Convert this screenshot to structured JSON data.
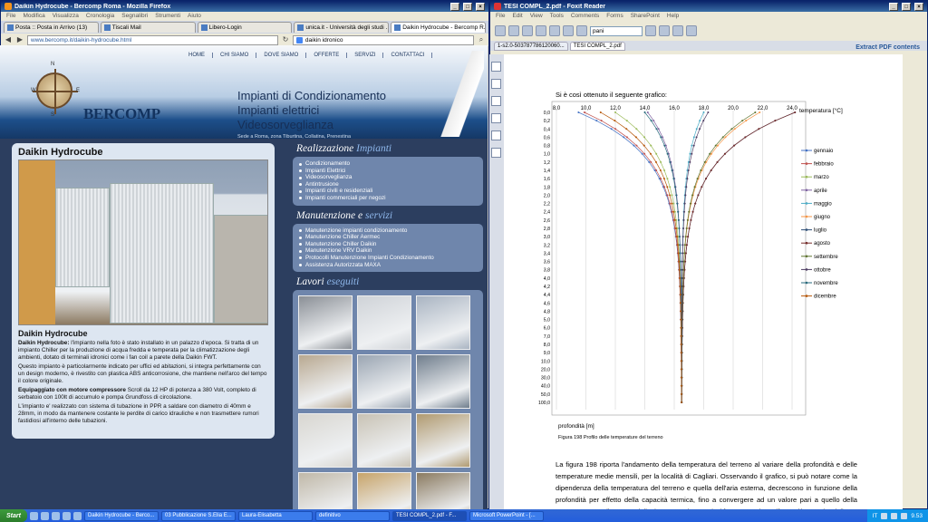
{
  "firefox": {
    "title": "Daikin Hydrocube - Bercomp Roma - Mozilla Firefox",
    "menu": [
      "File",
      "Modifica",
      "Visualizza",
      "Cronologia",
      "Segnalibri",
      "Strumenti",
      "Aiuto"
    ],
    "tabs": [
      "Posta :: Posta in Arrivo (13)",
      "Tiscali Mail",
      "Libero-Login",
      "unica.it - Università degli studi ...",
      "Daikin Hydrocube - Bercomp R..."
    ],
    "url": "www.bercomp.it/daikin-hydrocube.html",
    "search_value": "daikin idronico"
  },
  "site": {
    "nav": [
      "HOME",
      "CHI SIAMO",
      "DOVE SIAMO",
      "OFFERTE",
      "SERVIZI",
      "CONTATTACI"
    ],
    "logo": "BERCOMP",
    "compass": {
      "n": "N",
      "s": "S",
      "e": "E",
      "w": "W"
    },
    "headline": [
      "Impianti di Condizionamento",
      "Impianti elettrici",
      "Videosorveglianza"
    ],
    "tagline": "Sede a Roma, zona Tiburtina, Collatina, Prenestina",
    "product_title": "Daikin Hydrocube",
    "product_subtitle": "Daikin Hydrocube",
    "paragraphs": [
      {
        "bold": "Daikin Hydrocube:",
        "text": " l'impianto nella foto è stato installato in un palazzo d'epoca. Si tratta di un impianto Chiller per la produzione di acqua fredda e temperata per la climatizzazione degli ambienti, dotato di terminali idronici come i fan coil a parete della Daikin FWT."
      },
      {
        "bold": "",
        "text": "Questo impianto è particolarmente indicato per uffici ed abitazioni, si integra perfettamente con un design moderno, è rivestito con plastica ABS anticorrosione, che mantiene nell'arco del tempo il colore originale."
      },
      {
        "bold": "Equipaggiato con motore compressore",
        "text": " Scroll da 12 HP di potenza a 380 Volt, completo di serbatoio con 100lt di accumulo e pompa Grundfoss di circolazione."
      },
      {
        "bold": "",
        "text": "L'impianto e' realizzato con sistema di tubazione in PPR a saldare con diametro di 40mm e 28mm, in modo da mantenere costante le perdite di carico idrauliche e non trasmettere rumori fastidiosi all'interno delle tubazioni."
      }
    ],
    "sections": [
      {
        "title_a": "Realizzazione",
        "title_b": "Impianti",
        "items": [
          "Condizionamento",
          "Impianti Elettrici",
          "Videosorveglianza",
          "Antintrusione",
          "Impianti civili e residenziali",
          "Impianti commerciali per negozi"
        ]
      },
      {
        "title_a": "Manutenzione e",
        "title_b": "servizi",
        "items": [
          "Manutenzione impianti condizionamento",
          "Manutenzione Chiller Aermec",
          "Manutenzione Chiller Daikin",
          "Manutenzione VRV Daikin",
          "Protocolli Manutenzione Impianti Condizionamento",
          "Assistenza Autorizzata MAXA"
        ]
      }
    ],
    "gallery_title_a": "Lavori",
    "gallery_title_b": "eseguiti",
    "gallery_colors": [
      "#8a8f96",
      "#cfd3d8",
      "#a9b4c2",
      "#b8a890",
      "#9aa5b2",
      "#6f7d8c",
      "#d8d6d0",
      "#c8c2b4",
      "#b09a70",
      "#c0b8a8",
      "#c7a46a",
      "#8a7a60"
    ]
  },
  "foxit": {
    "title": "TESI COMPL_2.pdf - Foxit Reader",
    "menu": [
      "File",
      "Edit",
      "View",
      "Tools",
      "Comments",
      "Forms",
      "SharePoint",
      "Help"
    ],
    "search_value": "pani",
    "tabs": [
      "1-s2.0-503787786120060...",
      "TESI COMPL_2.pdf"
    ],
    "extract_label": "Extract PDF contents",
    "intro": "Si è così ottenuto il seguente grafico:",
    "caption": "Figura 198  Profilo delle temperature del terreno",
    "body": "La figura 198 riporta l'andamento della temperatura del terreno al variare della profondità e delle temperature medie mensili, per la località di Cagliari. Osservando il grafico, si può notare come la dipendenza della temperatura del terreno e quella dell'aria esterna, decrescono in funzione della profondità per effetto della capacità termica, fino a convergere ad un valore pari a quello della temperatura media annua dell'aria esterna (16,5 °C). Il fenomeno si manifesta già a partire dalle"
  },
  "chart_data": {
    "type": "line",
    "title": "",
    "xlabel": "temperatura [°C]",
    "ylabel": "profondità [m]",
    "xlim": [
      8,
      24
    ],
    "x_ticks": [
      "8,0",
      "10,0",
      "12,0",
      "14,0",
      "16,0",
      "18,0",
      "20,0",
      "22,0",
      "24,0"
    ],
    "y_ticks": [
      "0,0",
      "0,2",
      "0,4",
      "0,6",
      "0,8",
      "1,0",
      "1,2",
      "1,4",
      "1,6",
      "1,8",
      "2,0",
      "2,2",
      "2,4",
      "2,6",
      "2,8",
      "3,0",
      "3,2",
      "3,4",
      "3,6",
      "3,8",
      "4,0",
      "4,2",
      "4,4",
      "4,6",
      "4,8",
      "5,0",
      "6,0",
      "7,0",
      "8,0",
      "9,0",
      "10,0",
      "20,0",
      "30,0",
      "40,0",
      "50,0",
      "100,0"
    ],
    "depth_index": [
      0,
      1,
      2,
      3,
      4,
      5,
      6,
      7,
      8,
      9,
      10,
      11,
      12,
      13,
      14,
      15,
      16,
      17,
      18,
      19,
      20,
      21,
      22,
      23,
      24,
      25,
      26,
      27,
      28,
      29,
      30,
      31,
      32,
      33,
      34,
      35
    ],
    "series": [
      {
        "name": "gennaio",
        "color": "#4472c4",
        "surface": 9.5
      },
      {
        "name": "febbraio",
        "color": "#c0504d",
        "surface": 9.9
      },
      {
        "name": "marzo",
        "color": "#9bbb59",
        "surface": 12.0
      },
      {
        "name": "aprile",
        "color": "#8064a2",
        "surface": 14.2
      },
      {
        "name": "maggio",
        "color": "#4bacc6",
        "surface": 18.0
      },
      {
        "name": "giugno",
        "color": "#f79646",
        "surface": 21.8
      },
      {
        "name": "luglio",
        "color": "#2c4d75",
        "surface": 24.2
      },
      {
        "name": "agosto",
        "color": "#772c2a",
        "surface": 24.2
      },
      {
        "name": "settembre",
        "color": "#5f7530",
        "surface": 21.5
      },
      {
        "name": "ottobre",
        "color": "#4d3b62",
        "surface": 18.3
      },
      {
        "name": "novembre",
        "color": "#276a7c",
        "surface": 14.0
      },
      {
        "name": "dicembre",
        "color": "#b65708",
        "surface": 11.0
      }
    ],
    "mean_annual": 16.5,
    "legend_position": "right",
    "grid": true
  },
  "taskbar": {
    "start": "Start",
    "tasks": [
      "Daikin Hydrocube - Berco...",
      "03 Pubblicazione S.Elia E...",
      "Laura-Elisabetta",
      "definitivo",
      "TESI COMPL_2.pdf - F...",
      "Microsoft PowerPoint - [..."
    ],
    "clock": "9.53",
    "lang": "IT"
  }
}
